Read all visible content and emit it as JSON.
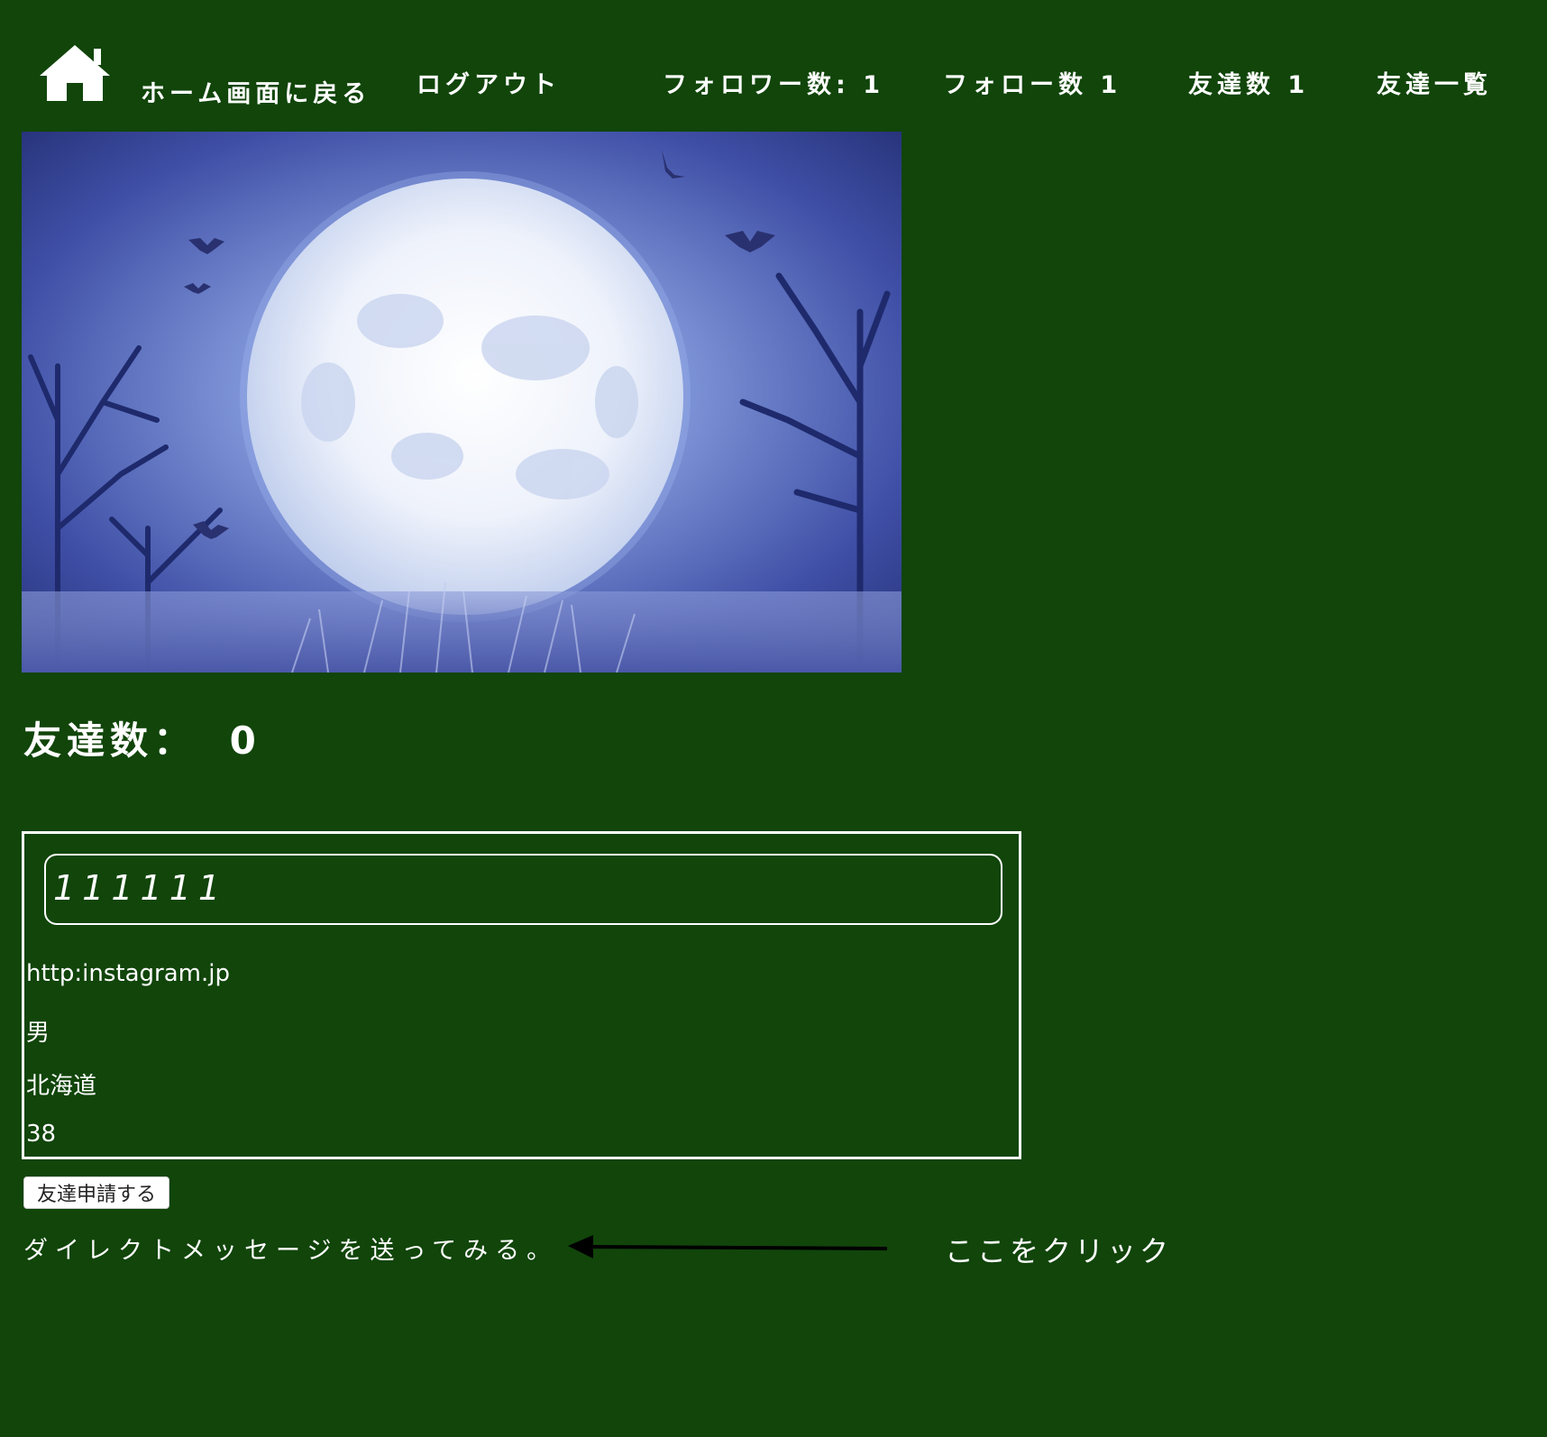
{
  "nav": {
    "home_label": "ホーム画面に戻る",
    "logout_label": "ログアウト",
    "followers_label": "フォロワー数: 1",
    "following_label": "フォロー数 1",
    "friends_label": "友達数 1",
    "friends_list_label": "友達一覧"
  },
  "friends_count": {
    "label": "友達数：",
    "value": "0"
  },
  "profile": {
    "name": "111111",
    "url": "http:instagram.jp",
    "gender": "男",
    "prefecture": "北海道",
    "age": "38"
  },
  "actions": {
    "friend_request_label": "友達申請する",
    "dm_label": "ダイレクトメッセージを送ってみる。",
    "click_hint": "ここをクリック"
  },
  "colors": {
    "background": "#11450a",
    "text": "#ffffff",
    "moon_scene": "#5a6fc2"
  }
}
